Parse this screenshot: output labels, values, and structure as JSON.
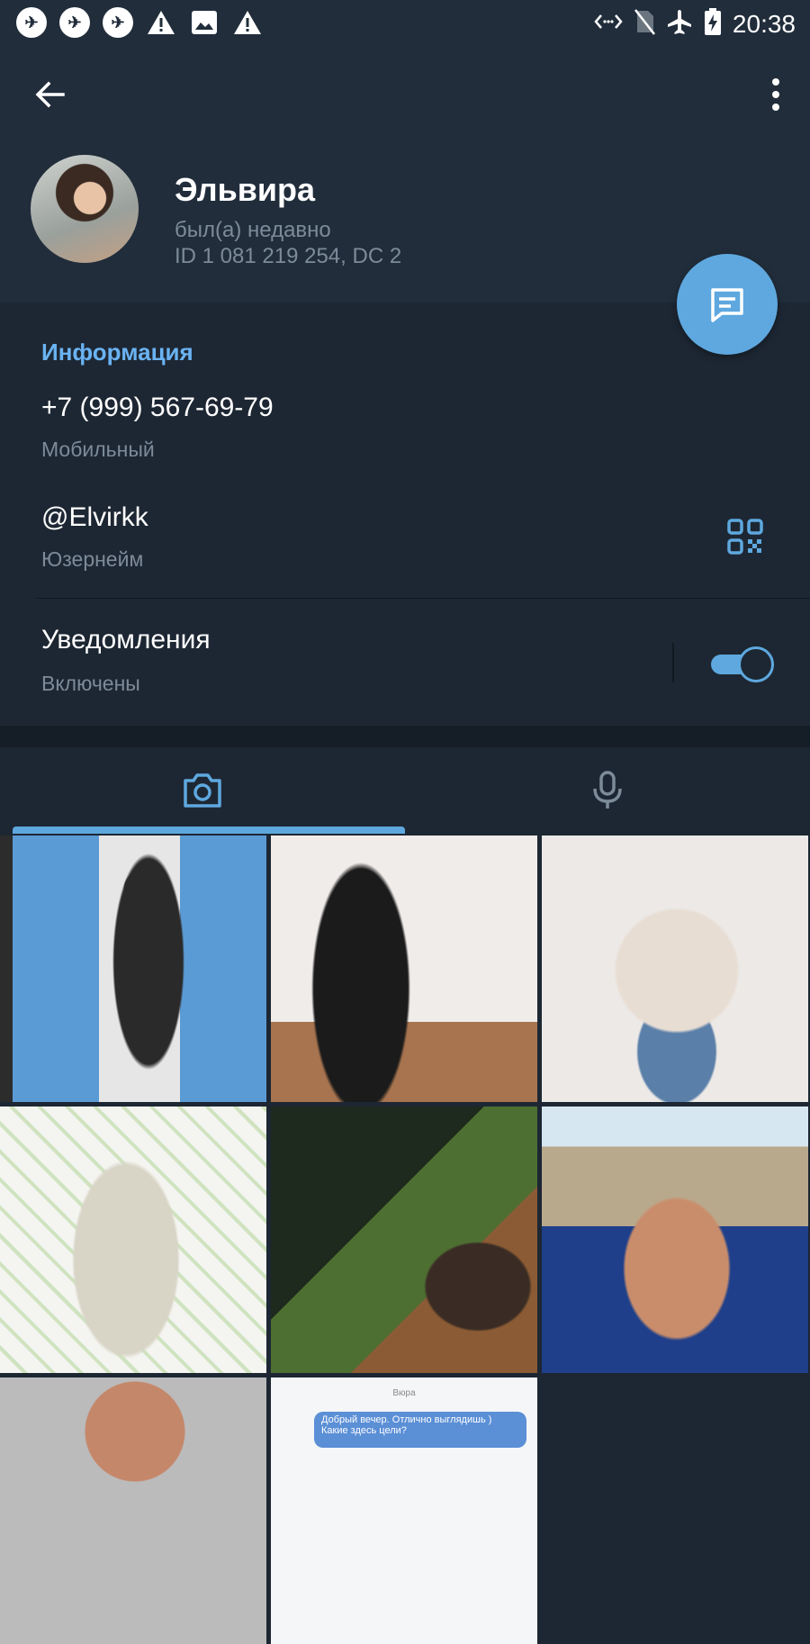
{
  "status_bar": {
    "time": "20:38",
    "left_icons": [
      "app-icon",
      "app-icon",
      "app-icon",
      "warning-icon",
      "image-icon",
      "warning-icon"
    ],
    "right_icons": [
      "data-saver-icon",
      "no-sim-icon",
      "airplane-icon",
      "battery-charging-icon"
    ]
  },
  "header": {
    "back_icon": "arrow-left-icon",
    "menu_icon": "more-vertical-icon",
    "name": "Эльвира",
    "last_seen": "был(а) недавно",
    "id_line": "ID 1 081 219 254, DC 2"
  },
  "info": {
    "section_title": "Информация",
    "phone": "+7 (999) 567-69-79",
    "phone_label": "Мобильный",
    "username": "@Elvirkk",
    "username_label": "Юзернейм",
    "notifications": "Уведомления",
    "notifications_state": "Включены",
    "notifications_on": true
  },
  "tabs": [
    {
      "icon": "camera-icon",
      "active": true
    },
    {
      "icon": "microphone-icon",
      "active": false
    }
  ],
  "media_preview": {
    "chat_header": "Вюра",
    "message": "Добрый вечер. Отлично выглядишь ) Какие здесь цели?"
  },
  "colors": {
    "header_bg": "#212d3b",
    "body_bg": "#1d2733",
    "accent": "#5ea8df",
    "section_title": "#6ab3f3",
    "secondary_text": "#7d8b99"
  }
}
